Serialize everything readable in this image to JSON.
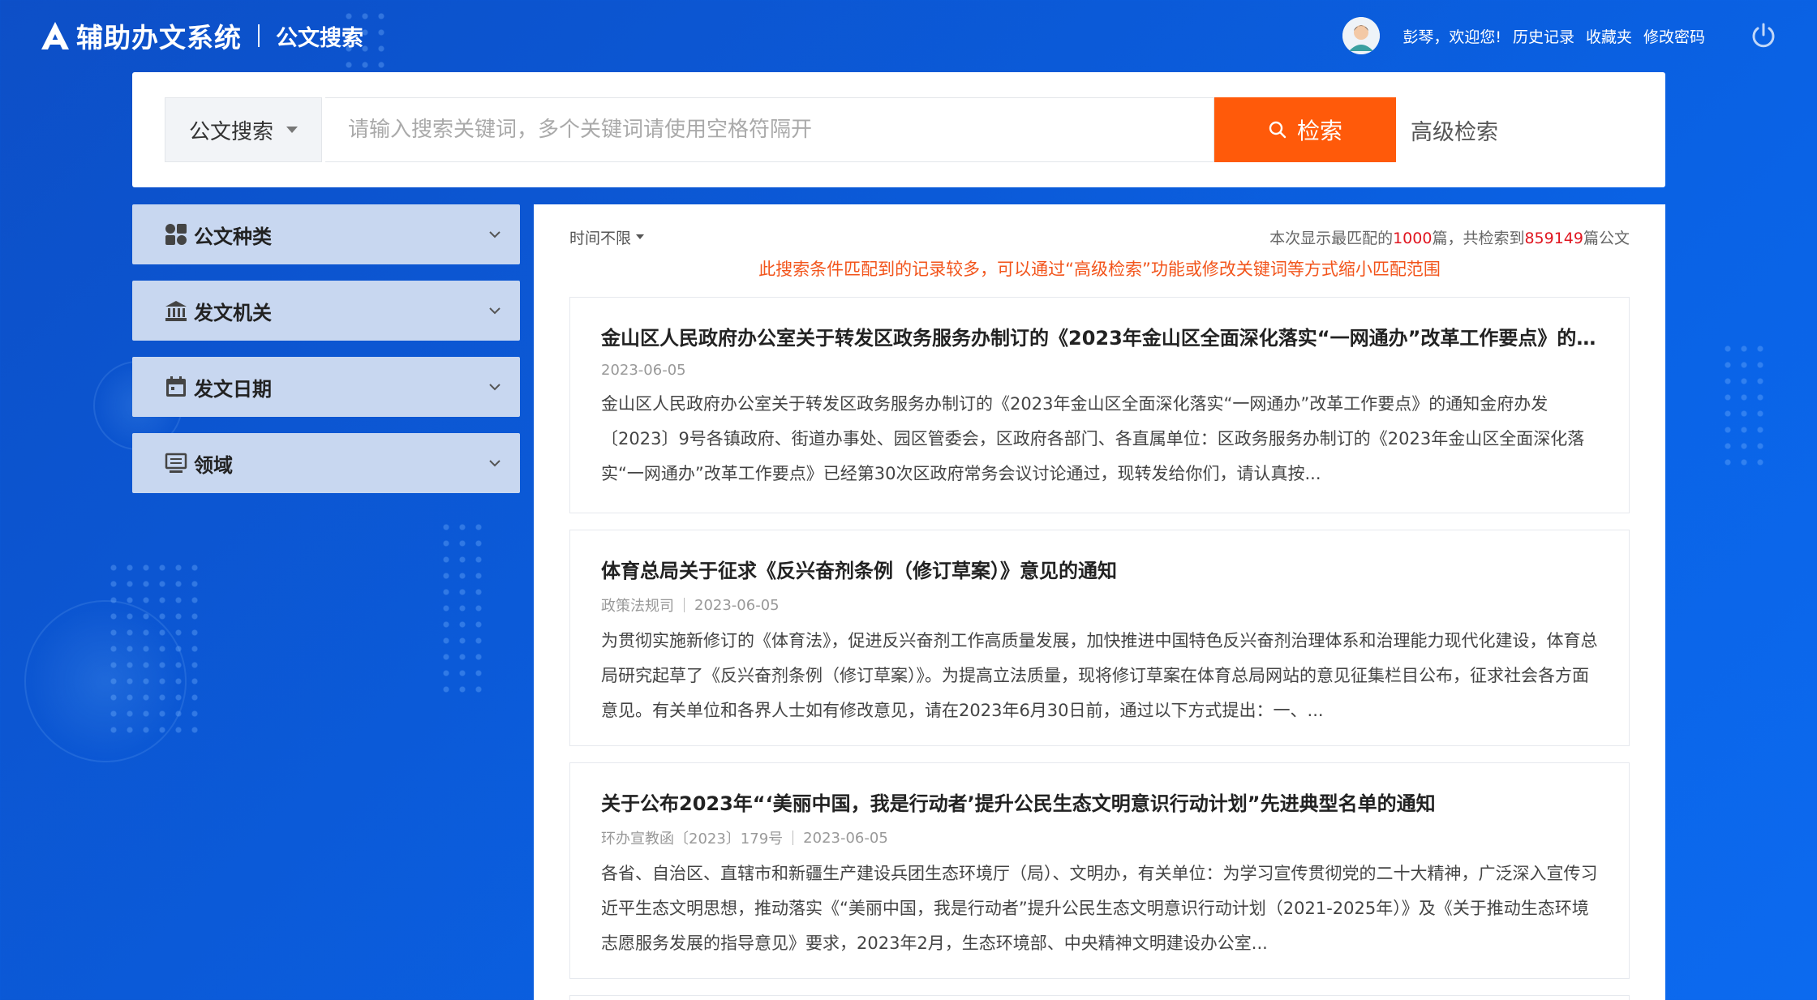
{
  "header": {
    "logo_text": "辅助办文系统",
    "logo_sub": "公文搜索",
    "welcome": "彭琴，欢迎您!",
    "links": [
      "历史记录",
      "收藏夹",
      "修改密码"
    ]
  },
  "search": {
    "type_label": "公文搜索",
    "placeholder": "请输入搜索关键词，多个关键词请使用空格符隔开",
    "button_label": "检索",
    "advanced_label": "高级检索",
    "button_color": "#ff5a0a"
  },
  "sidebar": {
    "filters": [
      {
        "label": "公文种类",
        "icon": "category-icon"
      },
      {
        "label": "发文机关",
        "icon": "bank-icon"
      },
      {
        "label": "发文日期",
        "icon": "calendar-icon"
      },
      {
        "label": "领域",
        "icon": "monitor-icon"
      }
    ]
  },
  "results": {
    "time_filter": "时间不限",
    "count_prefix": "本次显示最匹配的",
    "shown": "1000",
    "count_mid": "篇，共检索到",
    "total": "859149",
    "count_suffix": "篇公文",
    "notice": "此搜索条件匹配到的记录较多，可以通过“高级检索”功能或修改关键词等方式缩小匹配范围",
    "items": [
      {
        "title": "金山区人民政府办公室关于转发区政务服务办制订的《2023年金山区全面深化落实“一网通办”改革工作要点》的通知",
        "category": "",
        "date": "2023-06-05",
        "summary": "金山区人民政府办公室关于转发区政务服务办制订的《2023年金山区全面深化落实“一网通办”改革工作要点》的通知金府办发〔2023〕9号各镇政府、街道办事处、园区管委会，区政府各部门、各直属单位：区政务服务办制订的《2023年金山区全面深化落实“一网通办”改革工作要点》已经第30次区政府常务会议讨论通过，现转发给你们，请认真按..."
      },
      {
        "title": "体育总局关于征求《反兴奋剂条例（修订草案）》意见的通知",
        "category": "政策法规司",
        "date": "2023-06-05",
        "summary": "为贯彻实施新修订的《体育法》，促进反兴奋剂工作高质量发展，加快推进中国特色反兴奋剂治理体系和治理能力现代化建设，体育总局研究起草了《反兴奋剂条例（修订草案）》。为提高立法质量，现将修订草案在体育总局网站的意见征集栏目公布，征求社会各方面意见。有关单位和各界人士如有修改意见，请在2023年6月30日前，通过以下方式提出：一、..."
      },
      {
        "title": "关于公布2023年“‘美丽中国，我是行动者’提升公民生态文明意识行动计划”先进典型名单的通知",
        "category": "环办宣教函〔2023〕179号",
        "date": "2023-06-05",
        "summary": "各省、自治区、直辖市和新疆生产建设兵团生态环境厅（局）、文明办，有关单位：为学习宣传贯彻党的二十大精神，广泛深入宣传习近平生态文明思想，推动落实《“美丽中国，我是行动者”提升公民生态文明意识行动计划（2021-2025年）》及《关于推动生态环境志愿服务发展的指导意见》要求，2023年2月，生态环境部、中央精神文明建设办公室..."
      }
    ]
  }
}
